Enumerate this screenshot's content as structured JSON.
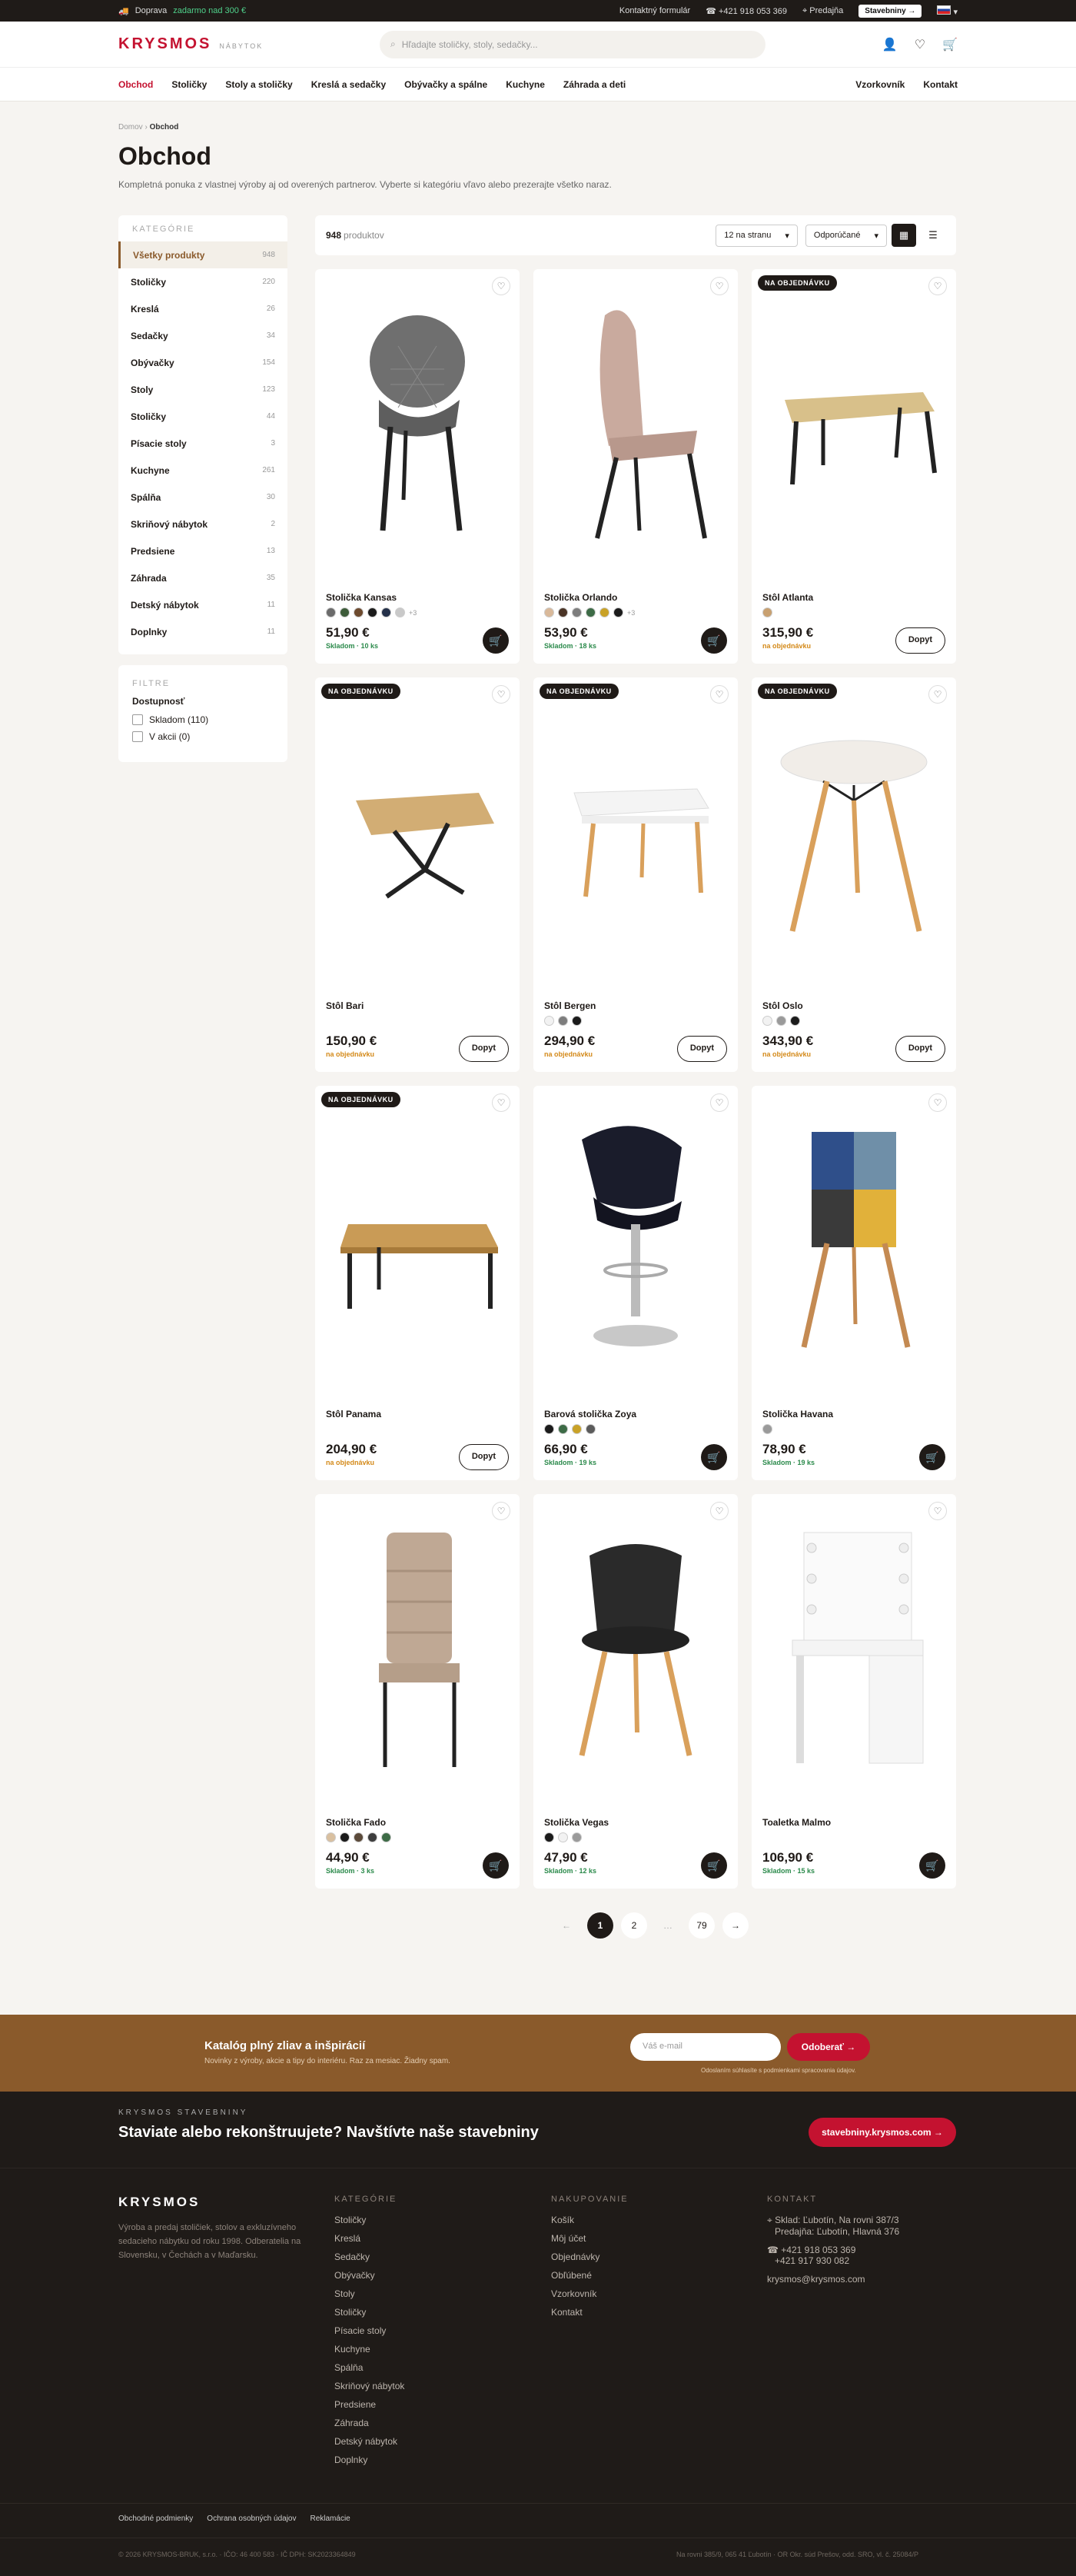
{
  "topbar": {
    "shipping_label": "Doprava",
    "shipping_highlight": "zadarmo nad 300 €",
    "contact_form": "Kontaktný formulár",
    "phone": "+421 918 053 369",
    "store": "Predajňa",
    "stavebniny": "Stavebniny"
  },
  "header": {
    "brand": "KRYSMOS",
    "sub": "NÁBYTOK",
    "search_placeholder": "Hľadajte stoličky, stoly, sedačky..."
  },
  "nav": {
    "items": [
      "Obchod",
      "Stoličky",
      "Stoly a stoličky",
      "Kreslá a sedačky",
      "Obývačky a spálne",
      "Kuchyne",
      "Záhrada a deti"
    ],
    "right": [
      "Vzorkovník",
      "Kontakt"
    ]
  },
  "breadcrumb": {
    "home": "Domov",
    "current": "Obchod"
  },
  "page": {
    "title": "Obchod",
    "lead": "Kompletná ponuka z vlastnej výroby aj od overených partnerov. Vyberte si kategóriu vľavo alebo prezerajte všetko naraz."
  },
  "sidebar": {
    "heading": "KATEGÓRIE",
    "categories": [
      {
        "label": "Všetky produkty",
        "count": "948"
      },
      {
        "label": "Stoličky",
        "count": "220"
      },
      {
        "label": "Kreslá",
        "count": "26"
      },
      {
        "label": "Sedačky",
        "count": "34"
      },
      {
        "label": "Obývačky",
        "count": "154"
      },
      {
        "label": "Stoly",
        "count": "123"
      },
      {
        "label": "Stoličky",
        "count": "44"
      },
      {
        "label": "Písacie stoly",
        "count": "3"
      },
      {
        "label": "Kuchyne",
        "count": "261"
      },
      {
        "label": "Spálňa",
        "count": "30"
      },
      {
        "label": "Skriňový nábytok",
        "count": "2"
      },
      {
        "label": "Predsiene",
        "count": "13"
      },
      {
        "label": "Záhrada",
        "count": "35"
      },
      {
        "label": "Detský nábytok",
        "count": "11"
      },
      {
        "label": "Doplnky",
        "count": "11"
      }
    ],
    "filters_heading": "FILTRE",
    "availability": "Dostupnosť",
    "in_stock": "Skladom (110)",
    "on_sale": "V akcii (0)"
  },
  "toolbar": {
    "count": "948",
    "count_label": "produktov",
    "per_page": "12 na stranu",
    "sort": "Odporúčané"
  },
  "products": [
    {
      "name": "Stolička Kansas",
      "price": "51,90 €",
      "stock": "Skladom · 10 ks",
      "in": true,
      "badge": "",
      "swatches": [
        "#6b6b6b",
        "#3d5c3a",
        "#6d4a2e",
        "#1b1b1b",
        "#243049",
        "#c9c9c9"
      ],
      "more": "+3",
      "cta": "cart",
      "img": "chair-grey"
    },
    {
      "name": "Stolička Orlando",
      "price": "53,90 €",
      "stock": "Skladom · 18 ks",
      "in": true,
      "badge": "",
      "swatches": [
        "#d9b99a",
        "#4a3426",
        "#7d7d7d",
        "#3d6b46",
        "#c9a227",
        "#1b1b1b"
      ],
      "more": "+3",
      "cta": "cart",
      "img": "chair-pink"
    },
    {
      "name": "Stôl Atlanta",
      "price": "315,90 €",
      "stock": "na objednávku",
      "in": false,
      "badge": "NA OBJEDNÁVKU",
      "swatches": [
        "#c8a070"
      ],
      "more": "",
      "cta": "Dopyt",
      "img": "table-wood"
    },
    {
      "name": "Stôl Bari",
      "price": "150,90 €",
      "stock": "na objednávku",
      "in": false,
      "badge": "NA OBJEDNÁVKU",
      "swatches": [],
      "more": "",
      "cta": "Dopyt",
      "img": "table-x"
    },
    {
      "name": "Stôl Bergen",
      "price": "294,90 €",
      "stock": "na objednávku",
      "in": false,
      "badge": "NA OBJEDNÁVKU",
      "swatches": [
        "#f2f2f2",
        "#7d7d7d",
        "#1b1b1b"
      ],
      "more": "",
      "cta": "Dopyt",
      "img": "table-white"
    },
    {
      "name": "Stôl Oslo",
      "price": "343,90 €",
      "stock": "na objednávku",
      "in": false,
      "badge": "NA OBJEDNÁVKU",
      "swatches": [
        "#f2f2f2",
        "#9a9a9a",
        "#1b1b1b"
      ],
      "more": "",
      "cta": "Dopyt",
      "img": "table-round"
    },
    {
      "name": "Stôl Panama",
      "price": "204,90 €",
      "stock": "na objednávku",
      "in": false,
      "badge": "NA OBJEDNÁVKU",
      "swatches": [],
      "more": "",
      "cta": "Dopyt",
      "img": "table-oak"
    },
    {
      "name": "Barová stolička Zoya",
      "price": "66,90 €",
      "stock": "Skladom · 19 ks",
      "in": true,
      "badge": "",
      "swatches": [
        "#1b1b1b",
        "#3d6b46",
        "#c9a227",
        "#5b5b5b"
      ],
      "more": "",
      "cta": "cart",
      "img": "bar-stool"
    },
    {
      "name": "Stolička Havana",
      "price": "78,90 €",
      "stock": "Skladom · 19 ks",
      "in": true,
      "badge": "",
      "swatches": [
        "#9a9a9a"
      ],
      "more": "",
      "cta": "cart",
      "img": "chair-patch"
    },
    {
      "name": "Stolička Fado",
      "price": "44,90 €",
      "stock": "Skladom · 3 ks",
      "in": true,
      "badge": "",
      "swatches": [
        "#d9c0a0",
        "#1b1b1b",
        "#5b4a3a",
        "#3d3d3d",
        "#3d6b46"
      ],
      "more": "",
      "cta": "cart",
      "img": "chair-fado"
    },
    {
      "name": "Stolička Vegas",
      "price": "47,90 €",
      "stock": "Skladom · 12 ks",
      "in": true,
      "badge": "",
      "swatches": [
        "#1b1b1b",
        "#f2f2f2",
        "#9a9a9a"
      ],
      "more": "",
      "cta": "cart",
      "img": "chair-vegas"
    },
    {
      "name": "Toaletka Malmo",
      "price": "106,90 €",
      "stock": "Skladom · 15 ks",
      "in": true,
      "badge": "",
      "swatches": [],
      "more": "",
      "cta": "cart",
      "img": "vanity"
    }
  ],
  "pager": {
    "prev": "←",
    "pages": [
      "1",
      "2",
      "…",
      "79"
    ],
    "next": "→"
  },
  "newsletter": {
    "title": "Katalóg plný zliav a inšpirácií",
    "text": "Novinky z výroby, akcie a tipy do interiéru. Raz za mesiac. Žiadny spam.",
    "placeholder": "Váš e-mail",
    "button": "Odoberať",
    "terms": "Odoslaním súhlasíte s podmienkami spracovania údajov."
  },
  "stavebniny": {
    "kicker": "KRYSMOS STAVEBNINY",
    "title": "Staviate alebo rekonštruujete? Navštívte naše stavebniny",
    "button": "stavebniny.krysmos.com"
  },
  "footer": {
    "brand": "KRYSMOS",
    "desc": "Výroba a predaj stoličiek, stolov a exkluzívneho sedacieho nábytku od roku 1998. Odberatelia na Slovensku, v Čechách a v Maďarsku.",
    "cat_heading": "KATEGÓRIE",
    "categories": [
      "Stoličky",
      "Kreslá",
      "Sedačky",
      "Obývačky",
      "Stoly",
      "Stoličky",
      "Písacie stoly",
      "Kuchyne",
      "Spálňa",
      "Skriňový nábytok",
      "Predsiene",
      "Záhrada",
      "Detský nábytok",
      "Doplnky"
    ],
    "shop_heading": "NAKUPOVANIE",
    "shop": [
      "Košík",
      "Môj účet",
      "Objednávky",
      "Obľúbené",
      "Vzorkovník",
      "Kontakt"
    ],
    "contact_heading": "KONTAKT",
    "addr1": "Sklad: Ľubotín, Na rovni 387/3",
    "addr2": "Predajňa: Ľubotín, Hlavná 376",
    "phone1": "+421 918 053 369",
    "phone2": "+421 917 930 082",
    "email": "krysmos@krysmos.com",
    "bottom_links": [
      "Obchodné podmienky",
      "Ochrana osobných údajov",
      "Reklamácie"
    ],
    "copy": "© 2026 KRYSMOS-BRUK, s.r.o. · IČO: 46 400 583 · IČ DPH: SK2023364849",
    "reg": "Na rovni 385/9, 065 41 Ľubotín · OR Okr. súd Prešov, odd. SRO, vl. č. 25084/P"
  }
}
